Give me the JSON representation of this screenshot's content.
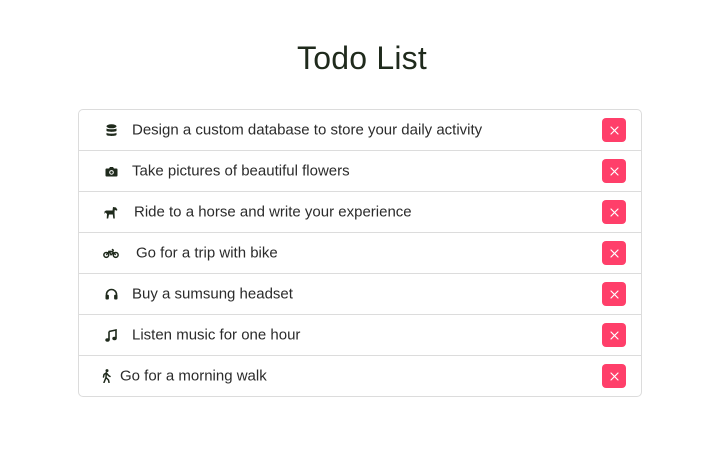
{
  "title": "Todo List",
  "accent_color": "#ff3f6a",
  "todos": [
    {
      "icon": "database-icon",
      "text": "Design a custom database to store your daily activity"
    },
    {
      "icon": "camera-icon",
      "text": "Take pictures of beautiful flowers"
    },
    {
      "icon": "horse-icon",
      "text": "Ride to a horse and write your experience"
    },
    {
      "icon": "motorcycle-icon",
      "text": "Go for a trip with bike"
    },
    {
      "icon": "headphones-icon",
      "text": "Buy a sumsung headset"
    },
    {
      "icon": "music-icon",
      "text": "Listen music for one hour"
    },
    {
      "icon": "walking-icon",
      "text": "Go for a morning walk"
    }
  ]
}
